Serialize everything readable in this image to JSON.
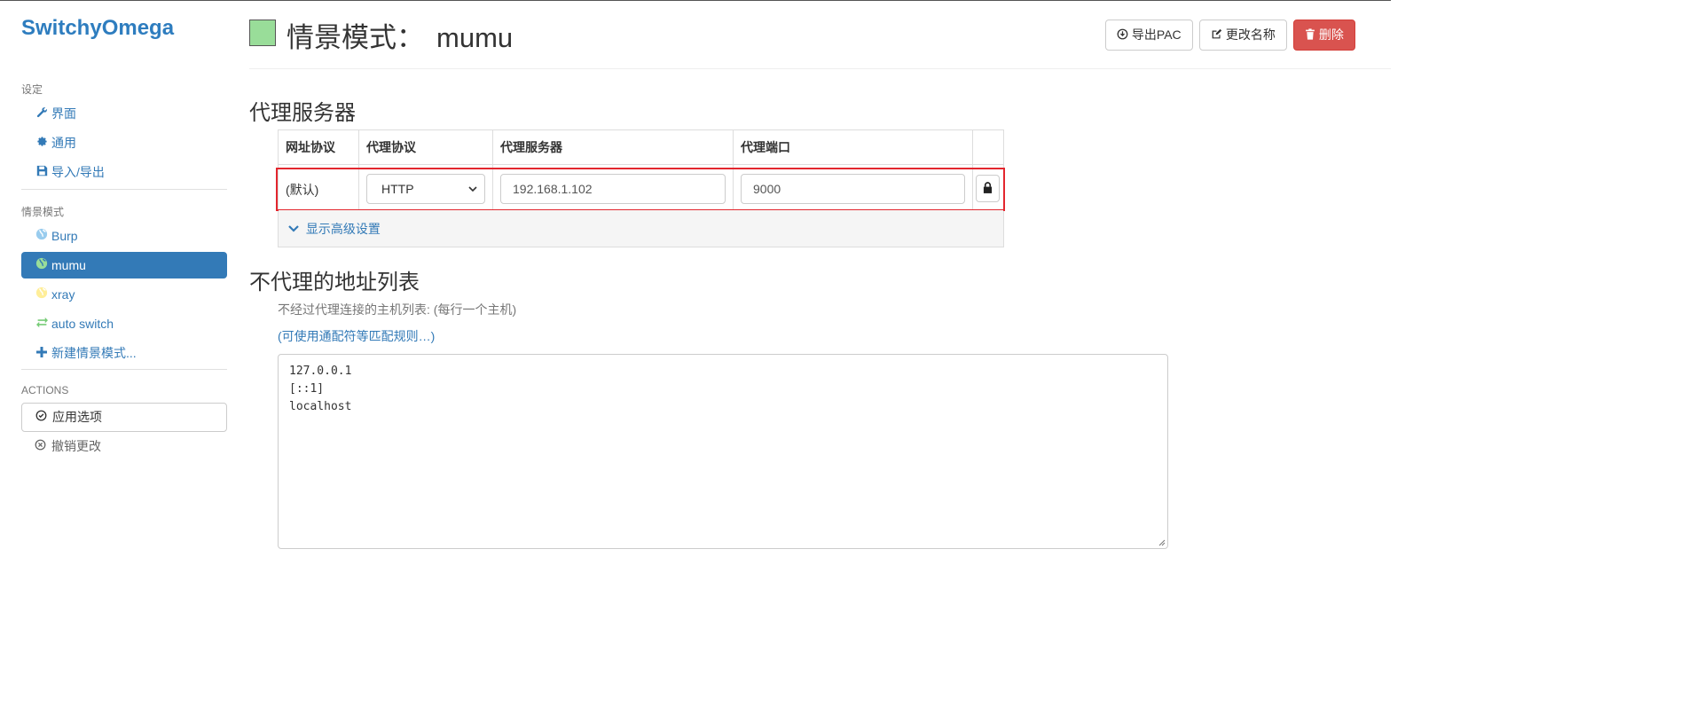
{
  "app": {
    "brand": "SwitchyOmega"
  },
  "sidebar": {
    "settings_header": "设定",
    "settings_items": [
      {
        "label": "界面",
        "icon": "wrench-icon"
      },
      {
        "label": "通用",
        "icon": "gear-icon"
      },
      {
        "label": "导入/导出",
        "icon": "floppy-icon"
      }
    ],
    "profiles_header": "情景模式",
    "profiles": [
      {
        "label": "Burp",
        "icon": "globe-icon",
        "color": "#99ccee"
      },
      {
        "label": "mumu",
        "icon": "globe-icon",
        "color": "#99dd99",
        "active": true
      },
      {
        "label": "xray",
        "icon": "globe-icon",
        "color": "#ffee99"
      },
      {
        "label": "auto switch",
        "icon": "switch-icon",
        "color": "#99dd99"
      },
      {
        "label": "新建情景模式...",
        "icon": "plus-icon"
      }
    ],
    "actions_header": "ACTIONS",
    "apply_label": "应用选项",
    "revert_label": "撤销更改"
  },
  "header": {
    "title_prefix": "情景模式：",
    "profile_name": "mumu",
    "profile_color": "#99dd99",
    "export_pac_label": "导出PAC",
    "rename_label": "更改名称",
    "delete_label": "删除"
  },
  "proxy_section": {
    "title": "代理服务器",
    "columns": [
      "网址协议",
      "代理协议",
      "代理服务器",
      "代理端口"
    ],
    "row": {
      "scheme": "(默认)",
      "protocol": "HTTP",
      "server": "192.168.1.102",
      "port": "9000"
    },
    "advanced_label": "显示高级设置"
  },
  "bypass_section": {
    "title": "不代理的地址列表",
    "description": "不经过代理连接的主机列表: (每行一个主机)",
    "wildcard_link": "(可使用通配符等匹配规则…)",
    "entries": "127.0.0.1\n[::1]\nlocalhost"
  }
}
